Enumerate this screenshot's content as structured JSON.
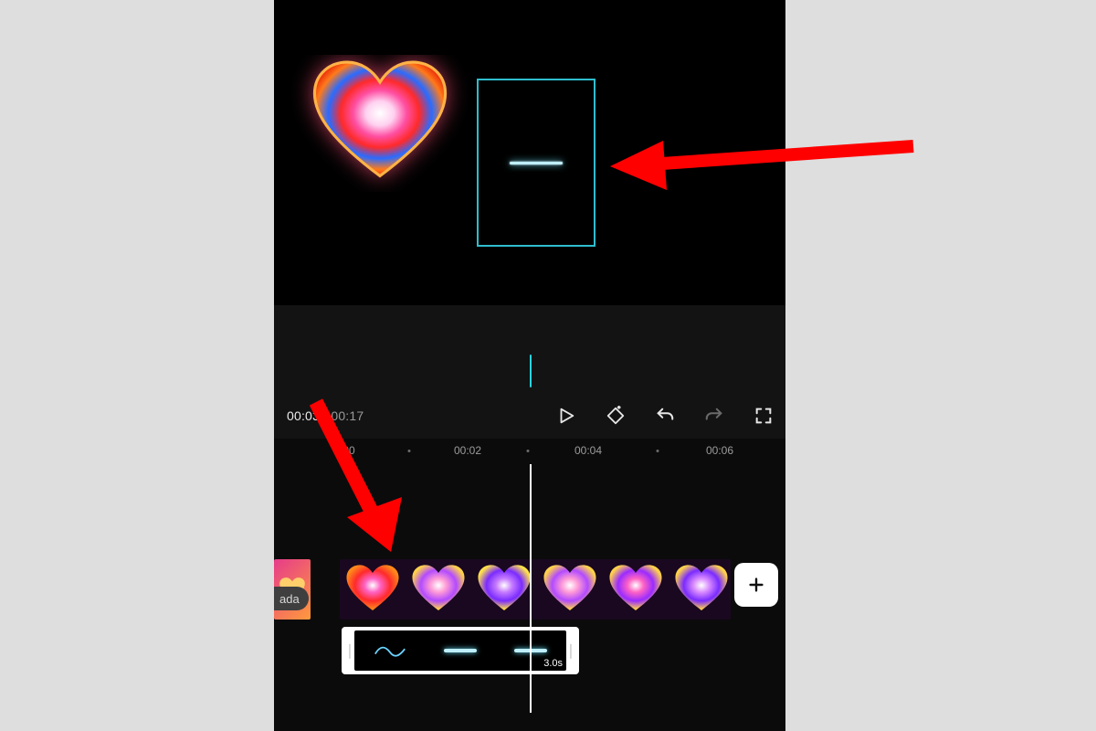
{
  "playback": {
    "current_time": "00:03",
    "separator": " / ",
    "total_time": "00:17"
  },
  "controls": {
    "play_icon": "play",
    "keyframe_icon": "keyframe-add",
    "undo_icon": "undo",
    "redo_icon": "redo",
    "fullscreen_icon": "fullscreen"
  },
  "ruler": {
    "ticks": [
      "00",
      "00:02",
      "00:04",
      "00:06"
    ]
  },
  "timeline": {
    "prev_clip_label": "ada",
    "add_label": "+",
    "effect_duration": "3.0s"
  },
  "annotations": {
    "arrow1_target": "overlay-box-in-preview",
    "arrow2_target": "clip-start-in-timeline"
  }
}
